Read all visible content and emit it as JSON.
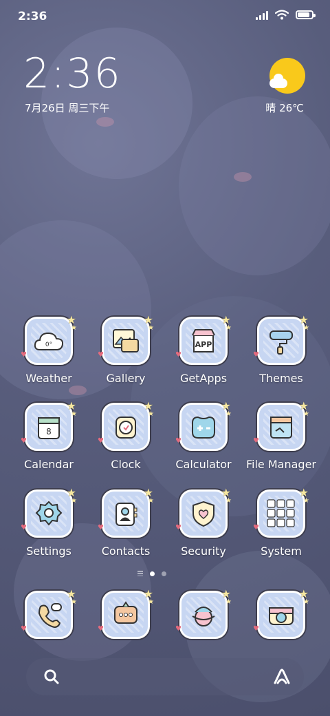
{
  "status_bar": {
    "time": "2:36",
    "battery_percent": 85
  },
  "clock_widget": {
    "time": "2:36",
    "date": "7月26日 周三下午",
    "weather": "晴 26℃",
    "weather_icon": "sunny-cloud-icon"
  },
  "apps": [
    {
      "label": "Weather",
      "icon": "weather-icon"
    },
    {
      "label": "Gallery",
      "icon": "gallery-icon"
    },
    {
      "label": "GetApps",
      "icon": "getapps-icon",
      "badge_text": "APP"
    },
    {
      "label": "Themes",
      "icon": "themes-icon"
    },
    {
      "label": "Calendar",
      "icon": "calendar-icon",
      "badge_text": "8"
    },
    {
      "label": "Clock",
      "icon": "clock-icon"
    },
    {
      "label": "Calculator",
      "icon": "calculator-icon"
    },
    {
      "label": "File Manager",
      "icon": "file-manager-icon"
    },
    {
      "label": "Settings",
      "icon": "settings-icon"
    },
    {
      "label": "Contacts",
      "icon": "contacts-icon"
    },
    {
      "label": "Security",
      "icon": "security-icon"
    },
    {
      "label": "System",
      "icon": "system-icon"
    }
  ],
  "weather_icon_text": "0°",
  "dock": [
    {
      "icon": "phone-icon"
    },
    {
      "icon": "messages-icon"
    },
    {
      "icon": "browser-icon"
    },
    {
      "icon": "camera-icon"
    }
  ],
  "pager": {
    "pages": 2,
    "current": 1
  },
  "colors": {
    "icon_fill": "#c7d6f2",
    "sun": "#f9c91b",
    "accent_heart": "#e36b7e"
  }
}
